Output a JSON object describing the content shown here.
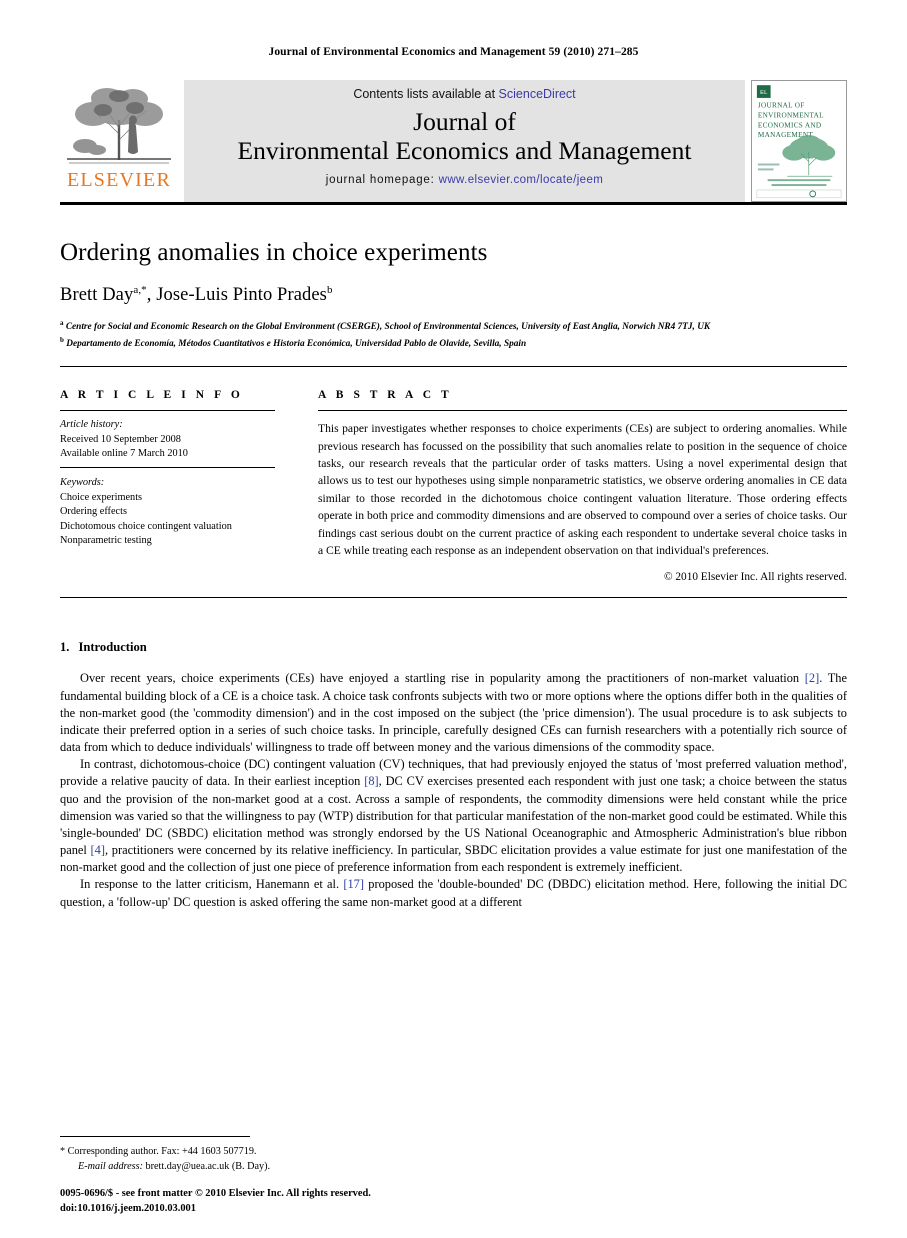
{
  "running_head": "Journal of Environmental Economics and Management 59 (2010) 271–285",
  "masthead": {
    "contents_prefix": "Contents lists available at ",
    "sciencedirect": "ScienceDirect",
    "journal_line1": "Journal of",
    "journal_line2": "Environmental Economics and Management",
    "homepage_label": "journal homepage: ",
    "homepage_url": "www.elsevier.com/locate/jeem",
    "publisher": "ELSEVIER",
    "cover_title_lines": [
      "JOURNAL OF",
      "ENVIRONMENTAL",
      "ECONOMICS AND",
      "MANAGEMENT"
    ],
    "link_color": "#3a3aa8",
    "publisher_color": "#E87722",
    "cover_color": "#1f6b46"
  },
  "article": {
    "title": "Ordering anomalies in choice experiments",
    "authors": "Brett Day",
    "author_sup_1": "a,*",
    "authors_2": ", Jose-Luis Pinto Prades",
    "author_sup_2": "b",
    "affiliation_a_sup": "a",
    "affiliation_a": "Centre for Social and Economic Research on the Global Environment (CSERGE), School of Environmental Sciences, University of East Anglia, Norwich NR4 7TJ, UK",
    "affiliation_b_sup": "b",
    "affiliation_b": "Departamento de Economía, Métodos Cuantitativos e Historia Económica, Universidad Pablo de Olavide, Sevilla, Spain"
  },
  "article_info": {
    "label": "A R T I C L E  I N F O",
    "history_label": "Article history:",
    "received": "Received 10 September 2008",
    "available": "Available online 7 March 2010",
    "keywords_label": "Keywords:",
    "keywords": [
      "Choice experiments",
      "Ordering effects",
      "Dichotomous choice contingent valuation",
      "Nonparametric testing"
    ]
  },
  "abstract": {
    "label": "A B S T R A C T",
    "text": "This paper investigates whether responses to choice experiments (CEs) are subject to ordering anomalies. While previous research has focussed on the possibility that such anomalies relate to position in the sequence of choice tasks, our research reveals that the particular order of tasks matters. Using a novel experimental design that allows us to test our hypotheses using simple nonparametric statistics, we observe ordering anomalies in CE data similar to those recorded in the dichotomous choice contingent valuation literature. Those ordering effects operate in both price and commodity dimensions and are observed to compound over a series of choice tasks. Our findings cast serious doubt on the current practice of asking each respondent to undertake several choice tasks in a CE while treating each response as an independent observation on that individual's preferences.",
    "copyright": "© 2010 Elsevier Inc. All rights reserved."
  },
  "introduction": {
    "number": "1.",
    "heading": "Introduction",
    "para1_a": "Over recent years, choice experiments (CEs) have enjoyed a startling rise in popularity among the practitioners of non-market valuation ",
    "para1_ref": "[2]",
    "para1_b": ". The fundamental building block of a CE is a choice task. A choice task confronts subjects with two or more options where the options differ both in the qualities of the non-market good (the 'commodity dimension') and in the cost imposed on the subject (the 'price dimension'). The usual procedure is to ask subjects to indicate their preferred option in a series of such choice tasks. In principle, carefully designed CEs can furnish researchers with a potentially rich source of data from which to deduce individuals' willingness to trade off between money and the various dimensions of the commodity space.",
    "para2_a": "In contrast, dichotomous-choice (DC) contingent valuation (CV) techniques, that had previously enjoyed the status of 'most preferred valuation method', provide a relative paucity of data. In their earliest inception ",
    "para2_ref1": "[8]",
    "para2_b": ", DC CV exercises presented each respondent with just one task; a choice between the status quo and the provision of the non-market good at a cost. Across a sample of respondents, the commodity dimensions were held constant while the price dimension was varied so that the willingness to pay (WTP) distribution for that particular manifestation of the non-market good could be estimated. While this 'single-bounded' DC (SBDC) elicitation method was strongly endorsed by the US National Oceanographic and Atmospheric Administration's blue ribbon panel ",
    "para2_ref2": "[4]",
    "para2_c": ", practitioners were concerned by its relative inefficiency. In particular, SBDC elicitation provides a value estimate for just one manifestation of the non-market good and the collection of just one piece of preference information from each respondent is extremely inefficient.",
    "para3_a": "In response to the latter criticism, Hanemann et al. ",
    "para3_ref": "[17]",
    "para3_b": " proposed the 'double-bounded' DC (DBDC) elicitation method. Here, following the initial DC question, a 'follow-up' DC question is asked offering the same non-market good at a different"
  },
  "footnotes": {
    "corresponding_marker": "*",
    "corresponding": "Corresponding author. Fax: +44 1603 507719.",
    "email_label": "E-mail address:",
    "email": "brett.day@uea.ac.uk (B. Day)."
  },
  "imprint": {
    "issn_line": "0095-0696/$ - see front matter © 2010 Elsevier Inc. All rights reserved.",
    "doi_line": "doi:10.1016/j.jeem.2010.03.001"
  }
}
